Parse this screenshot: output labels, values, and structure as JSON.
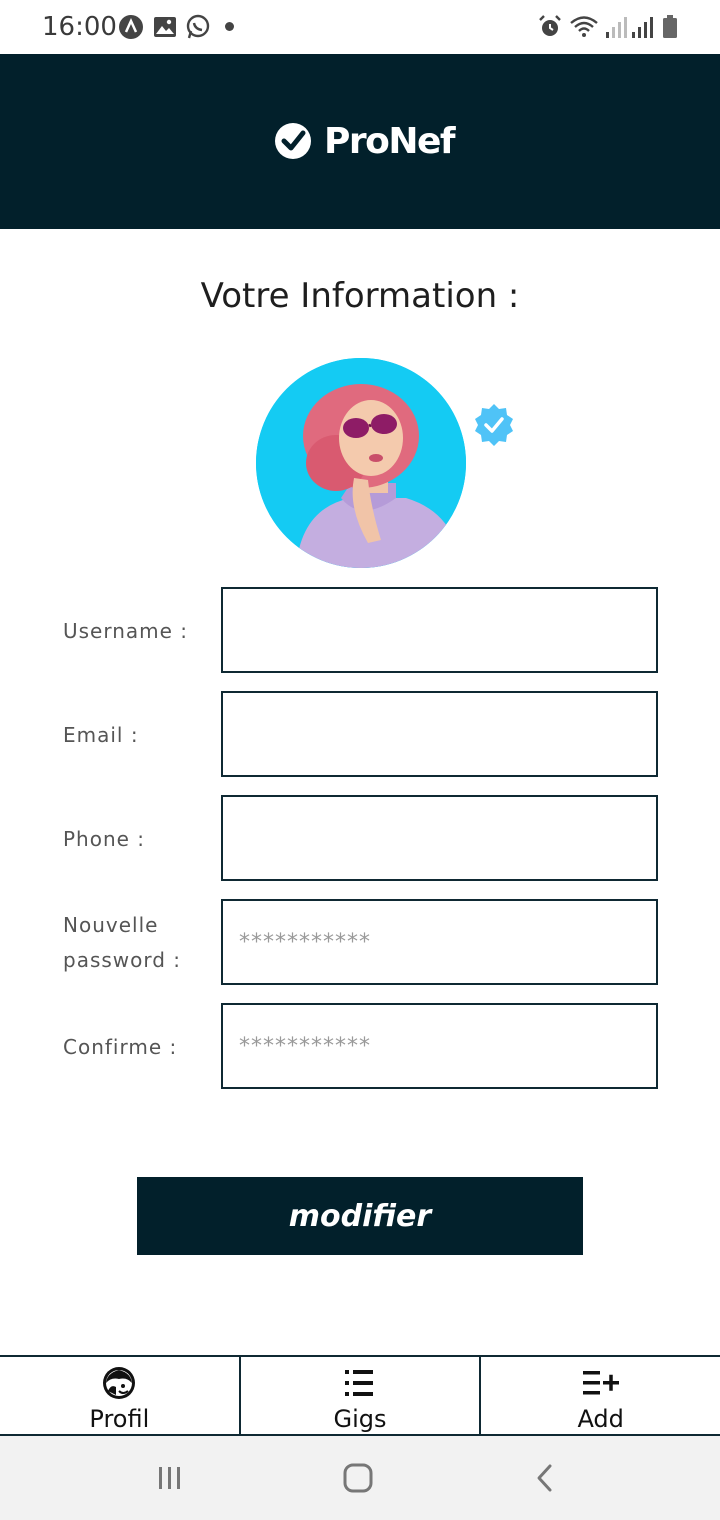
{
  "status_bar": {
    "time": "16:00"
  },
  "header": {
    "logo_text": "ProNef",
    "brand_color": "#02202b"
  },
  "page": {
    "title": "Votre Information :"
  },
  "form": {
    "fields": [
      {
        "label": "Username :",
        "value": "",
        "placeholder": ""
      },
      {
        "label": "Email :",
        "value": "",
        "placeholder": ""
      },
      {
        "label": "Phone :",
        "value": "",
        "placeholder": ""
      },
      {
        "label": "Nouvelle password :",
        "value": "",
        "placeholder": "***********"
      },
      {
        "label": "Confirme :",
        "value": "",
        "placeholder": "***********"
      }
    ],
    "submit_label": "modifier"
  },
  "bottom_nav": {
    "items": [
      {
        "label": "Profil",
        "icon": "profile-icon"
      },
      {
        "label": "Gigs",
        "icon": "list-icon"
      },
      {
        "label": "Add",
        "icon": "add-list-icon"
      }
    ]
  },
  "colors": {
    "avatar_bg": "#14cbf3",
    "verified_badge": "#4fc3f7",
    "system_nav_bg": "#f2f2f2"
  }
}
